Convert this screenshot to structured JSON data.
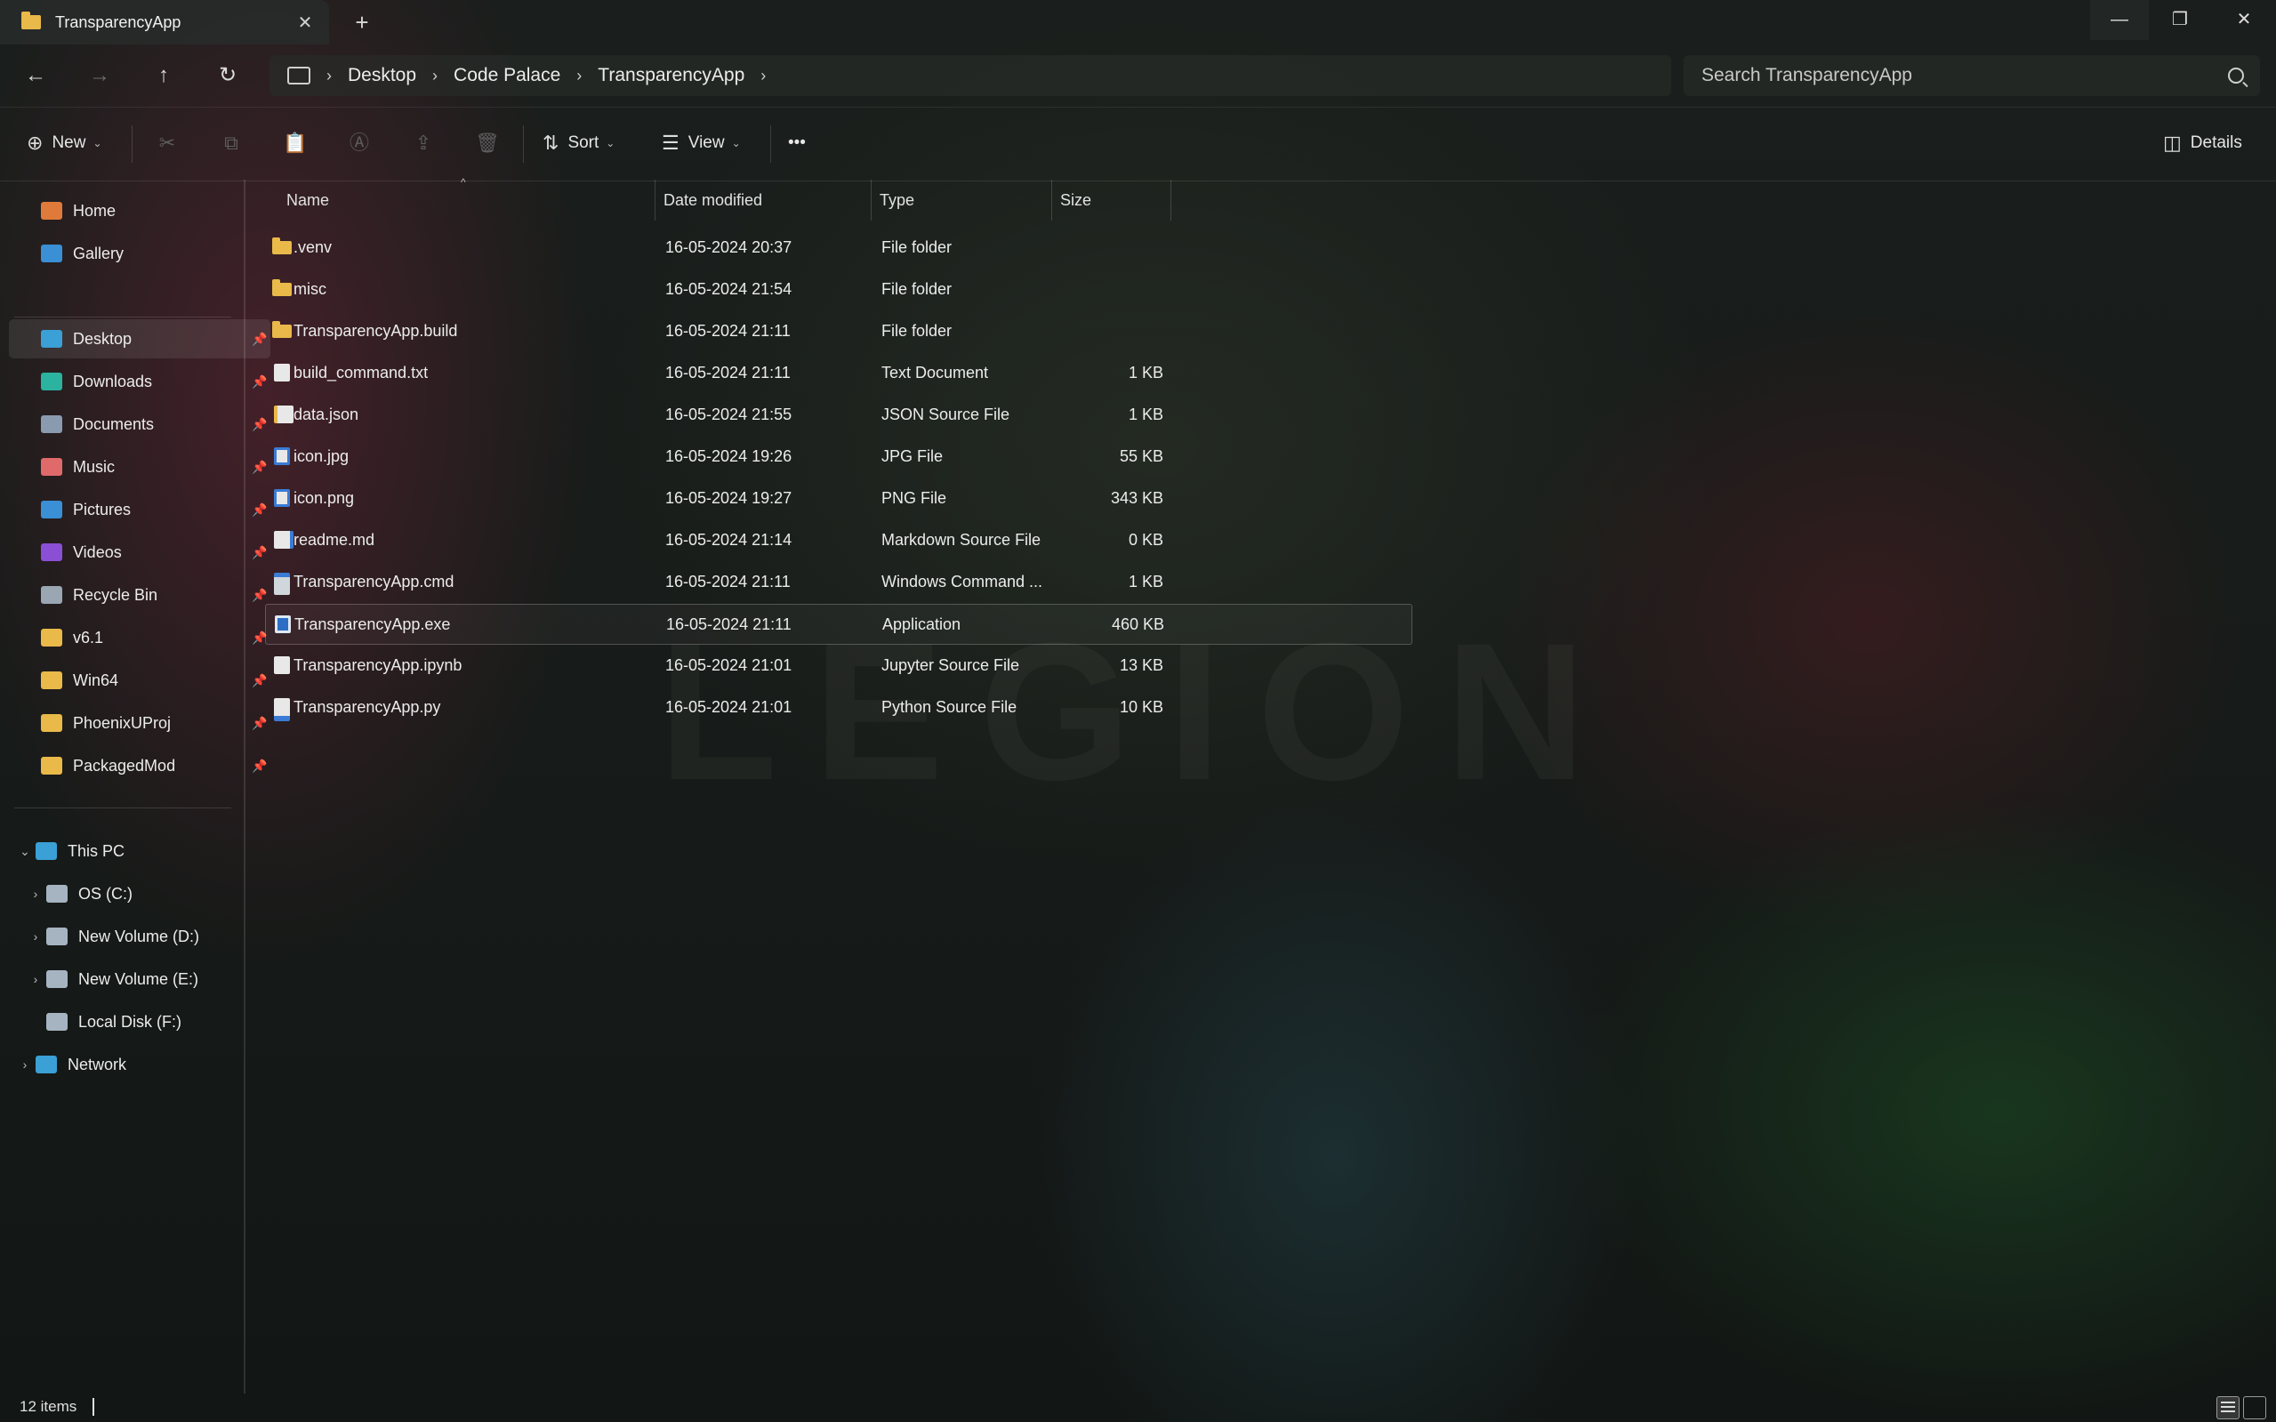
{
  "window": {
    "tab_title": "TransparencyApp",
    "tab_icon": "folder-icon",
    "new_tab": "+",
    "close_tab": "✕",
    "minimize": "—",
    "restore": "❐",
    "close": "✕"
  },
  "navigation": {
    "back": "←",
    "forward": "→",
    "up": "↑",
    "refresh": "↻",
    "breadcrumbs": [
      "Desktop",
      "Code Palace",
      "TransparencyApp"
    ],
    "search_placeholder": "Search TransparencyApp"
  },
  "toolbar": {
    "new_label": "New",
    "sort_label": "Sort",
    "view_label": "View",
    "more_label": "•••",
    "details_label": "Details",
    "icons": [
      "cut-icon",
      "copy-icon",
      "paste-icon",
      "rename-icon",
      "share-icon",
      "delete-icon"
    ]
  },
  "sidebar": {
    "quick": [
      {
        "label": "Home",
        "icon": "home-icon",
        "color": "#e07a3a"
      },
      {
        "label": "Gallery",
        "icon": "gallery-icon",
        "color": "#3a8fd5"
      }
    ],
    "pinned": [
      {
        "label": "Desktop",
        "icon": "desktop-icon",
        "color": "#3aa0d5",
        "pin": "📌"
      },
      {
        "label": "Downloads",
        "icon": "downloads-icon",
        "color": "#2bb3a0",
        "pin": "📌"
      },
      {
        "label": "Documents",
        "icon": "documents-icon",
        "color": "#8a9bb0",
        "pin": "📌"
      },
      {
        "label": "Music",
        "icon": "music-icon",
        "color": "#e06a6a",
        "pin": "📌"
      },
      {
        "label": "Pictures",
        "icon": "pictures-icon",
        "color": "#3a8fd5",
        "pin": "📌"
      },
      {
        "label": "Videos",
        "icon": "videos-icon",
        "color": "#8a4fd5",
        "pin": "📌"
      },
      {
        "label": "Recycle Bin",
        "icon": "recycle-bin-icon",
        "color": "#9aa6b2",
        "pin": "📌"
      },
      {
        "label": "v6.1",
        "icon": "folder-icon",
        "color": "#e9b949",
        "pin": "📌"
      },
      {
        "label": "Win64",
        "icon": "folder-icon",
        "color": "#e9b949",
        "pin": "📌"
      },
      {
        "label": "PhoenixUProj",
        "icon": "folder-icon",
        "color": "#e9b949",
        "pin": "📌"
      },
      {
        "label": "PackagedMod",
        "icon": "folder-icon",
        "color": "#e9b949",
        "pin": "📌"
      }
    ],
    "this_pc": {
      "label": "This PC",
      "icon": "pc-icon",
      "color": "#3aa0d5",
      "expanded": "⌄"
    },
    "drives": [
      {
        "label": "OS (C:)",
        "icon": "drive-icon",
        "color": "#a6b4c2",
        "expander": "›"
      },
      {
        "label": "New Volume (D:)",
        "icon": "drive-icon",
        "color": "#a6b4c2",
        "expander": "›"
      },
      {
        "label": "New Volume (E:)",
        "icon": "drive-icon",
        "color": "#a6b4c2",
        "expander": "›"
      },
      {
        "label": "Local Disk (F:)",
        "icon": "locked-drive-icon",
        "color": "#a6b4c2",
        "expander": ""
      }
    ],
    "network": {
      "label": "Network",
      "icon": "network-icon",
      "color": "#3aa0d5",
      "expander": "›"
    }
  },
  "file_list": {
    "columns": {
      "name": "Name",
      "date": "Date modified",
      "type": "Type",
      "size": "Size"
    },
    "sort_indicator": "^",
    "rows": [
      {
        "name": ".venv",
        "date": "16-05-2024 20:37",
        "type": "File folder",
        "size": "",
        "icon": "folder"
      },
      {
        "name": "misc",
        "date": "16-05-2024 21:54",
        "type": "File folder",
        "size": "",
        "icon": "folder"
      },
      {
        "name": "TransparencyApp.build",
        "date": "16-05-2024 21:11",
        "type": "File folder",
        "size": "",
        "icon": "folder"
      },
      {
        "name": "build_command.txt",
        "date": "16-05-2024 21:11",
        "type": "Text Document",
        "size": "1 KB",
        "icon": "doc"
      },
      {
        "name": "data.json",
        "date": "16-05-2024 21:55",
        "type": "JSON Source File",
        "size": "1 KB",
        "icon": "json"
      },
      {
        "name": "icon.jpg",
        "date": "16-05-2024 19:26",
        "type": "JPG File",
        "size": "55 KB",
        "icon": "img"
      },
      {
        "name": "icon.png",
        "date": "16-05-2024 19:27",
        "type": "PNG File",
        "size": "343 KB",
        "icon": "img"
      },
      {
        "name": "readme.md",
        "date": "16-05-2024 21:14",
        "type": "Markdown Source File",
        "size": "0 KB",
        "icon": "md"
      },
      {
        "name": "TransparencyApp.cmd",
        "date": "16-05-2024 21:11",
        "type": "Windows Command ...",
        "size": "1 KB",
        "icon": "cmd"
      },
      {
        "name": "TransparencyApp.exe",
        "date": "16-05-2024 21:11",
        "type": "Application",
        "size": "460 KB",
        "icon": "exe",
        "selected": true
      },
      {
        "name": "TransparencyApp.ipynb",
        "date": "16-05-2024 21:01",
        "type": "Jupyter Source File",
        "size": "13 KB",
        "icon": "doc"
      },
      {
        "name": "TransparencyApp.py",
        "date": "16-05-2024 21:01",
        "type": "Python Source File",
        "size": "10 KB",
        "icon": "py"
      }
    ]
  },
  "status": {
    "item_count": "12 items"
  },
  "wallpaper": {
    "watermark": "LEGION"
  }
}
